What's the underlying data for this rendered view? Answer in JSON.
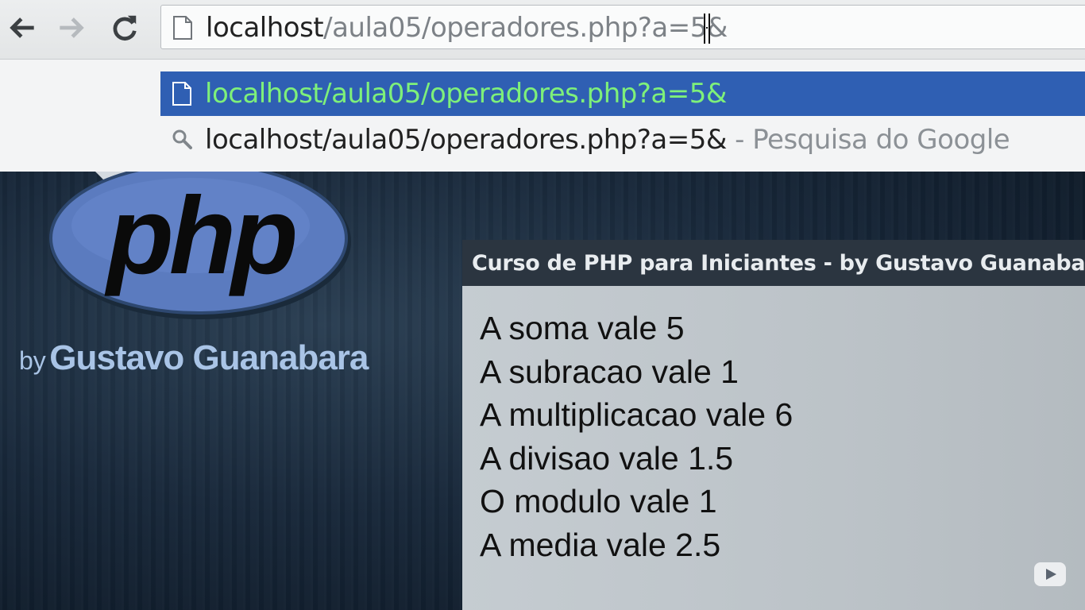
{
  "browser": {
    "url_host": "localhost",
    "url_path": "/aula05/operadores.php?a=5&",
    "suggestions": [
      {
        "text": "localhost/aula05/operadores.php?a=5&",
        "extra": "",
        "selected": true,
        "icon": "page-icon"
      },
      {
        "text": "localhost/aula05/operadores.php?a=5&",
        "extra": " - Pesquisa do Google",
        "selected": false,
        "icon": "search-icon"
      }
    ]
  },
  "page": {
    "logo_text": "php",
    "byline_by": "by",
    "byline_name": "Gustavo Guanabara",
    "panel_title": "Curso de PHP para Iniciantes - by Gustavo Guanabara",
    "results": [
      "A soma vale 5",
      "A subracao vale 1",
      "A multiplicacao vale 6",
      "A divisao vale 1.5",
      "O modulo vale 1",
      "A media vale 2.5"
    ]
  },
  "colors": {
    "selection": "#2f5fb3",
    "selection_text": "#7ef07a",
    "php_blue": "#5b7bbf",
    "byline": "#a9c4e6"
  }
}
